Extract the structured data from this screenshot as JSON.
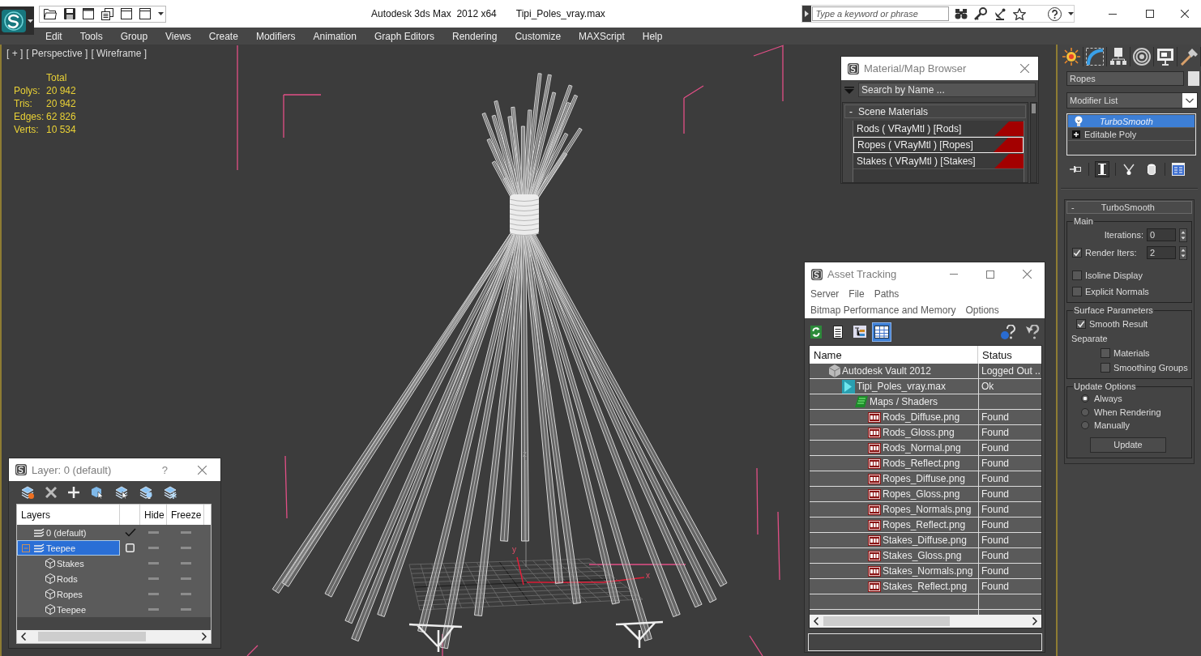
{
  "title_bar": {
    "app_name": "Autodesk 3ds Max  2012 x64",
    "file_name": "Tipi_Poles_vray.max",
    "search": {
      "placeholder": "Type a keyword or phrase"
    }
  },
  "menu_bar": [
    "Edit",
    "Tools",
    "Group",
    "Views",
    "Create",
    "Modifiers",
    "Animation",
    "Graph Editors",
    "Rendering",
    "Customize",
    "MAXScript",
    "Help"
  ],
  "viewport": {
    "labels": [
      "[ + ]",
      "[ Perspective ]",
      "[ Wireframe ]"
    ],
    "stats": {
      "header": "Total",
      "rows": [
        {
          "label": "Polys:",
          "value": "20 942"
        },
        {
          "label": "Tris:",
          "value": "20 942"
        },
        {
          "label": "Edges:",
          "value": "62 826"
        },
        {
          "label": "Verts:",
          "value": "10 534"
        }
      ]
    },
    "axis_labels": [
      "z",
      "y",
      "x"
    ]
  },
  "command_panel": {
    "object_name": "Ropes",
    "modifier_list": "Modifier List",
    "stack": [
      {
        "name": "TurboSmooth",
        "kind": "modifier",
        "selected": true
      },
      {
        "name": "Editable Poly",
        "kind": "object",
        "selected": false
      }
    ],
    "stack_tools": [
      {
        "kind": "pin",
        "on": false
      },
      {
        "kind": "result",
        "on": true
      },
      {
        "kind": "unique",
        "on": false
      },
      {
        "kind": "remove",
        "on": false
      },
      {
        "kind": "configure",
        "on": false
      }
    ],
    "rollout": {
      "toggle": "-",
      "title": "TurboSmooth",
      "main": {
        "label": "Main",
        "iterations": {
          "label": "Iterations:",
          "value": "0"
        },
        "render_iters": {
          "label": "Render Iters:",
          "checked": true,
          "value": "2"
        },
        "options": [
          {
            "label": "Isoline Display",
            "checked": false
          },
          {
            "label": "Explicit Normals",
            "checked": false
          }
        ]
      },
      "surface_parameters": {
        "label": "Surface Parameters",
        "smooth_result": {
          "label": "Smooth Result",
          "checked": true
        },
        "separate": {
          "label": "Separate",
          "options": [
            {
              "label": "Materials",
              "checked": false
            },
            {
              "label": "Smoothing Groups",
              "checked": false
            }
          ]
        }
      },
      "update_options": {
        "label": "Update Options",
        "options": [
          {
            "label": "Always",
            "selected": true
          },
          {
            "label": "When Rendering",
            "selected": false
          },
          {
            "label": "Manually",
            "selected": false
          }
        ],
        "button": "Update"
      }
    }
  },
  "material_browser": {
    "title": "Material/Map Browser",
    "search": {
      "placeholder": "Search by Name ..."
    },
    "group": {
      "toggle": "-",
      "label": "Scene Materials"
    },
    "materials": [
      {
        "name": "Rods ( VRayMtl ) [Rods]",
        "selected": false
      },
      {
        "name": "Ropes ( VRayMtl ) [Ropes]",
        "selected": true
      },
      {
        "name": "Stakes ( VRayMtl ) [Stakes]",
        "selected": false
      }
    ]
  },
  "asset_tracking": {
    "title": "Asset Tracking",
    "menus": [
      [
        "Server",
        "File",
        "Paths"
      ],
      [
        "Bitmap Performance and Memory",
        "Options"
      ]
    ],
    "toolbar": [
      {
        "kind": "refresh",
        "selected": false
      },
      {
        "kind": "list",
        "selected": false
      },
      {
        "kind": "tree",
        "selected": false
      },
      {
        "kind": "table",
        "selected": true
      }
    ],
    "columns": [
      "Name",
      "Status"
    ],
    "tree": [
      {
        "name": "Autodesk Vault 2012",
        "status": "Logged Out ..",
        "kind": "vault",
        "children": [
          {
            "name": "Tipi_Poles_vray.max",
            "status": "Ok",
            "kind": "scene",
            "children": [
              {
                "name": "Maps / Shaders",
                "kind": "folder",
                "children": [
                  {
                    "name": "Rods_Diffuse.png",
                    "status": "Found",
                    "kind": "bitmap"
                  },
                  {
                    "name": "Rods_Gloss.png",
                    "status": "Found",
                    "kind": "bitmap"
                  },
                  {
                    "name": "Rods_Normal.png",
                    "status": "Found",
                    "kind": "bitmap"
                  },
                  {
                    "name": "Rods_Reflect.png",
                    "status": "Found",
                    "kind": "bitmap"
                  },
                  {
                    "name": "Ropes_Diffuse.png",
                    "status": "Found",
                    "kind": "bitmap"
                  },
                  {
                    "name": "Ropes_Gloss.png",
                    "status": "Found",
                    "kind": "bitmap"
                  },
                  {
                    "name": "Ropes_Normals.png",
                    "status": "Found",
                    "kind": "bitmap"
                  },
                  {
                    "name": "Ropes_Reflect.png",
                    "status": "Found",
                    "kind": "bitmap"
                  },
                  {
                    "name": "Stakes_Diffuse.png",
                    "status": "Found",
                    "kind": "bitmap"
                  },
                  {
                    "name": "Stakes_Gloss.png",
                    "status": "Found",
                    "kind": "bitmap"
                  },
                  {
                    "name": "Stakes_Normals.png",
                    "status": "Found",
                    "kind": "bitmap"
                  },
                  {
                    "name": "Stakes_Reflect.png",
                    "status": "Found",
                    "kind": "bitmap"
                  }
                ]
              }
            ]
          }
        ]
      }
    ]
  },
  "layer_manager": {
    "title": "Layer: 0 (default)",
    "help": "?",
    "columns": [
      "Layers",
      "Hide",
      "Freeze"
    ],
    "layers": [
      {
        "name": "0 (default)",
        "current": true,
        "selected": false,
        "hidden": false,
        "frozen": false
      },
      {
        "name": "Teepee",
        "current": false,
        "selected": true,
        "expanded": true,
        "hidden": false,
        "frozen": false,
        "children": [
          {
            "name": "Stakes",
            "selected": false,
            "hidden": false,
            "frozen": false
          },
          {
            "name": "Rods",
            "selected": false,
            "hidden": false,
            "frozen": false
          },
          {
            "name": "Ropes",
            "selected": false,
            "hidden": false,
            "frozen": false
          },
          {
            "name": "Teepee",
            "selected": false,
            "hidden": false,
            "frozen": false
          }
        ]
      }
    ]
  }
}
